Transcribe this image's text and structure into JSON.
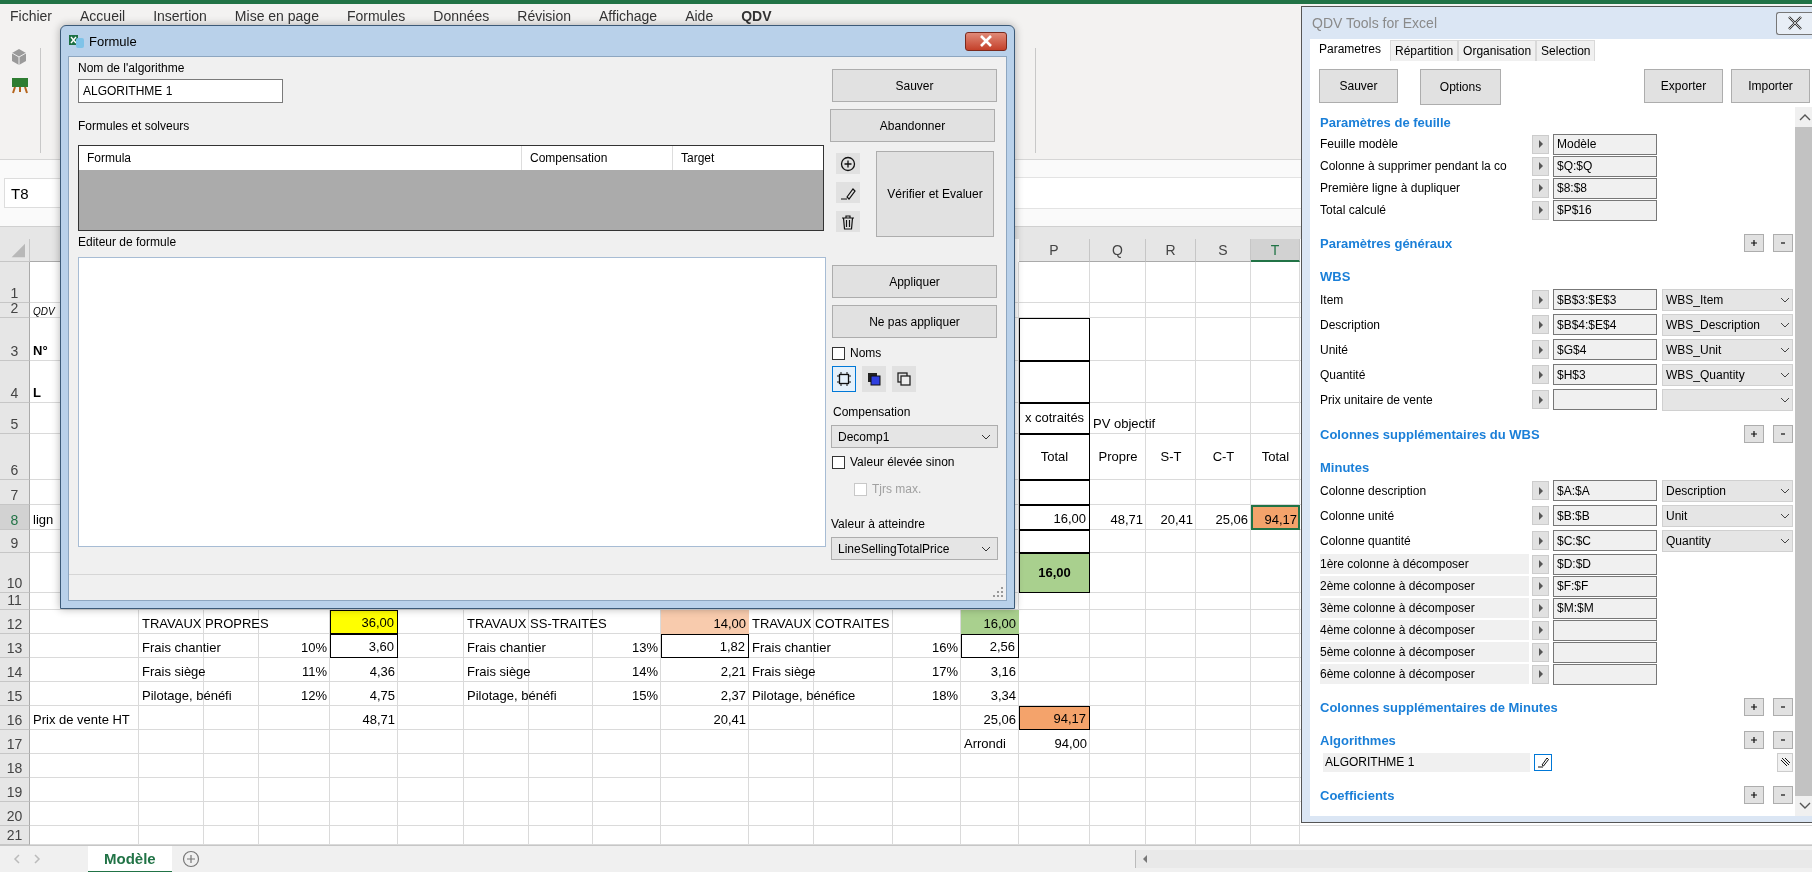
{
  "excel": {
    "menu": [
      {
        "label": "Fichier",
        "selected": false
      },
      {
        "label": "Accueil",
        "selected": false
      },
      {
        "label": "Insertion",
        "selected": false
      },
      {
        "label": "Mise en page",
        "selected": false
      },
      {
        "label": "Formules",
        "selected": false
      },
      {
        "label": "Données",
        "selected": false
      },
      {
        "label": "Révision",
        "selected": false
      },
      {
        "label": "Affichage",
        "selected": false
      },
      {
        "label": "Aide",
        "selected": false
      },
      {
        "label": "QDV",
        "selected": true
      }
    ],
    "name_box": {
      "value": "T8"
    },
    "columns": [
      {
        "letter": "P",
        "selected": false
      },
      {
        "letter": "Q",
        "selected": false
      },
      {
        "letter": "R",
        "selected": false
      },
      {
        "letter": "S",
        "selected": false
      },
      {
        "letter": "T",
        "selected": true
      }
    ],
    "rows": [
      {
        "label": "1",
        "selected": false
      },
      {
        "label": "2",
        "selected": false,
        "cells": {
          "A": {
            "text": "QDV",
            "kind": "note",
            "selected": false
          }
        }
      },
      {
        "label": "3",
        "selected": false,
        "cells": {
          "A": {
            "text": "N°",
            "kind": "text",
            "bold": true,
            "selected": false
          },
          "P": {
            "kind": "text",
            "boxed": true,
            "selected": false
          }
        }
      },
      {
        "label": "4",
        "selected": false,
        "cells": {
          "A": {
            "text": "L",
            "kind": "text",
            "bold": true,
            "selected": false
          },
          "P": {
            "kind": "text",
            "boxed": true,
            "selected": false
          }
        }
      },
      {
        "label": "5",
        "selected": false,
        "cells": {
          "P": {
            "text": "x cotraités",
            "kind": "head",
            "boxed": true,
            "selected": false
          },
          "Q": {
            "text": "PV objectif",
            "kind": "text",
            "selected": false
          }
        }
      },
      {
        "label": "6",
        "selected": false,
        "cells": {
          "P": {
            "text": "Total",
            "kind": "head",
            "boxed": true,
            "selected": false
          },
          "Q": {
            "text": "Propre",
            "kind": "head",
            "selected": false
          },
          "R": {
            "text": "S-T",
            "kind": "head",
            "selected": false
          },
          "S": {
            "text": "C-T",
            "kind": "head",
            "selected": false
          },
          "T": {
            "text": "Total",
            "kind": "head",
            "selected": false
          }
        }
      },
      {
        "label": "7",
        "selected": false,
        "cells": {
          "P": {
            "kind": "text",
            "boxed": true,
            "selected": false
          }
        }
      },
      {
        "label": "8",
        "selected": true,
        "cells": {
          "A": {
            "text": "lign",
            "kind": "text",
            "selected": false
          },
          "P": {
            "text": "16,00",
            "kind": "num",
            "boxed": true,
            "selected": false
          },
          "Q": {
            "text": "48,71",
            "kind": "num",
            "selected": false
          },
          "R": {
            "text": "20,41",
            "kind": "num",
            "selected": false
          },
          "S": {
            "text": "25,06",
            "kind": "num",
            "selected": false
          },
          "T": {
            "text": "94,17",
            "kind": "num",
            "color": "#f4a36b",
            "selected": true
          }
        }
      },
      {
        "label": "9",
        "selected": false,
        "cells": {
          "P": {
            "kind": "text",
            "boxed": true,
            "selected": false
          }
        }
      },
      {
        "label": "10",
        "selected": false,
        "cells": {
          "P": {
            "text": "16,00",
            "kind": "head",
            "bold": true,
            "boxed": true,
            "color": "#a9d08e",
            "selected": false
          }
        }
      },
      {
        "label": "11",
        "selected": false
      },
      {
        "label": "12",
        "selected": false,
        "cells": {
          "B": {
            "text": "TRAVAUX PROPRES",
            "kind": "text",
            "selected": false
          },
          "E": {
            "text": "36,00",
            "kind": "num",
            "boxed": true,
            "color": "#ffff00",
            "selected": false
          },
          "G": {
            "text": "TRAVAUX SS-TRAITES",
            "kind": "text",
            "selected": false
          },
          "J": {
            "text": "14,00",
            "kind": "num",
            "color": "#f8cbad",
            "selected": false
          },
          "K": {
            "text": "TRAVAUX COTRAITES",
            "kind": "text",
            "selected": false
          },
          "N": {
            "text": "16,00",
            "kind": "num",
            "color": "#a9d08e",
            "selected": false
          }
        }
      },
      {
        "label": "13",
        "selected": false,
        "cells": {
          "B": {
            "text": "Frais chantier",
            "kind": "text",
            "selected": false
          },
          "D": {
            "text": "10%",
            "kind": "num",
            "selected": false
          },
          "E": {
            "text": "3,60",
            "kind": "num",
            "boxed": true,
            "selected": false
          },
          "G": {
            "text": "Frais chantier",
            "kind": "text",
            "selected": false
          },
          "I": {
            "text": "13%",
            "kind": "num",
            "selected": false
          },
          "J": {
            "text": "1,82",
            "kind": "num",
            "boxed": true,
            "selected": false
          },
          "K": {
            "text": "Frais chantier",
            "kind": "text",
            "selected": false
          },
          "M": {
            "text": "16%",
            "kind": "num",
            "selected": false
          },
          "N": {
            "text": "2,56",
            "kind": "num",
            "boxed": true,
            "selected": false
          }
        }
      },
      {
        "label": "14",
        "selected": false,
        "cells": {
          "B": {
            "text": "Frais siège",
            "kind": "text",
            "selected": false
          },
          "D": {
            "text": "11%",
            "kind": "num",
            "selected": false
          },
          "E": {
            "text": "4,36",
            "kind": "num",
            "selected": false
          },
          "G": {
            "text": "Frais siège",
            "kind": "text",
            "selected": false
          },
          "I": {
            "text": "14%",
            "kind": "num",
            "selected": false
          },
          "J": {
            "text": "2,21",
            "kind": "num",
            "selected": false
          },
          "K": {
            "text": "Frais siège",
            "kind": "text",
            "selected": false
          },
          "M": {
            "text": "17%",
            "kind": "num",
            "selected": false
          },
          "N": {
            "text": "3,16",
            "kind": "num",
            "selected": false
          }
        }
      },
      {
        "label": "15",
        "selected": false,
        "cells": {
          "B": {
            "text": "Pilotage, bénéfi",
            "kind": "text",
            "selected": false
          },
          "D": {
            "text": "12%",
            "kind": "num",
            "selected": false
          },
          "E": {
            "text": "4,75",
            "kind": "num",
            "selected": false
          },
          "G": {
            "text": "Pilotage, bénéfi",
            "kind": "text",
            "selected": false
          },
          "I": {
            "text": "15%",
            "kind": "num",
            "selected": false
          },
          "J": {
            "text": "2,37",
            "kind": "num",
            "selected": false
          },
          "K": {
            "text": "Pilotage, bénéfice",
            "kind": "text",
            "selected": false
          },
          "M": {
            "text": "18%",
            "kind": "num",
            "selected": false
          },
          "N": {
            "text": "3,34",
            "kind": "num",
            "selected": false
          }
        }
      },
      {
        "label": "16",
        "selected": false,
        "cells": {
          "A": {
            "text": "Prix de vente HT",
            "kind": "text",
            "selected": false
          },
          "E": {
            "text": "48,71",
            "kind": "num",
            "selected": false
          },
          "J": {
            "text": "20,41",
            "kind": "num",
            "selected": false
          },
          "N": {
            "text": "25,06",
            "kind": "num",
            "selected": false
          },
          "P": {
            "text": "94,17",
            "kind": "num",
            "boxed": true,
            "color": "#f4a36b",
            "selected": false
          }
        }
      },
      {
        "label": "17",
        "selected": false,
        "cells": {
          "N": {
            "text": "Arrondi",
            "kind": "text",
            "selected": false
          },
          "P": {
            "text": "94,00",
            "kind": "num",
            "selected": false
          }
        }
      },
      {
        "label": "18",
        "selected": false
      },
      {
        "label": "19",
        "selected": false
      },
      {
        "label": "20",
        "selected": false
      },
      {
        "label": "21",
        "selected": false
      }
    ],
    "sheet_tabs": [
      {
        "label": "Modèle",
        "selected": true
      }
    ]
  },
  "formula_dialog": {
    "title": "Formule",
    "name_label": "Nom de l'algorithme",
    "name_value": "ALGORITHME 1",
    "top_buttons": [
      "Sauver",
      "Abandonner"
    ],
    "table_label": "Formules et solveurs",
    "table_columns": [
      "Formula",
      "Compensation",
      "Target"
    ],
    "verify_button": "Vérifier et Evaluer",
    "editor_label": "Editeur de formule",
    "apply_buttons": [
      "Appliquer",
      "Ne pas appliquer"
    ],
    "names_checkbox": {
      "label": "Noms",
      "checked": false
    },
    "view_buttons": [
      {
        "kind": "frame",
        "selected": true
      },
      {
        "kind": "filled",
        "selected": false
      },
      {
        "kind": "outline",
        "selected": false
      }
    ],
    "compensation": {
      "label": "Compensation",
      "value": "Decomp1"
    },
    "high_value": {
      "label": "Valeur élevée sinon",
      "checked": false,
      "disabled": false
    },
    "always_max": {
      "label": "Tjrs max.",
      "checked": false,
      "disabled": true
    },
    "target": {
      "label": "Valeur à atteindre",
      "value": "LineSellingTotalPrice"
    }
  },
  "tools_panel": {
    "title": "QDV Tools for Excel",
    "tabs": [
      {
        "label": "Parametres",
        "selected": true
      },
      {
        "label": "Répartition",
        "selected": false
      },
      {
        "label": "Organisation",
        "selected": false
      },
      {
        "label": "Selection",
        "selected": false
      }
    ],
    "buttons": [
      "Sauver",
      "Options",
      "Exporter",
      "Importer"
    ],
    "sections": [
      {
        "heading": "Paramètres de feuille",
        "add_remove": false,
        "rows": [
          {
            "label": "Feuille modèle",
            "kind": "ref",
            "value": "Modèle"
          },
          {
            "label": "Colonne à supprimer pendant la co",
            "kind": "ref",
            "value": "$Q:$Q"
          },
          {
            "label": "Première ligne à dupliquer",
            "kind": "ref",
            "value": "$8:$8"
          },
          {
            "label": "Total calculé",
            "kind": "ref",
            "value": "$P$16"
          }
        ]
      },
      {
        "heading": "Paramètres généraux",
        "add_remove": true
      },
      {
        "heading": "WBS",
        "add_remove": false,
        "rows": [
          {
            "label": "Item",
            "kind": "ref_select",
            "value": "$B$3:$E$3",
            "option": "WBS_Item"
          },
          {
            "label": "Description",
            "kind": "ref_select",
            "value": "$B$4:$E$4",
            "option": "WBS_Description"
          },
          {
            "label": "Unité",
            "kind": "ref_select",
            "value": "$G$4",
            "option": "WBS_Unit"
          },
          {
            "label": "Quantité",
            "kind": "ref_select",
            "value": "$H$3",
            "option": "WBS_Quantity"
          },
          {
            "label": "Prix unitaire de vente",
            "kind": "ref_select"
          }
        ]
      },
      {
        "heading": "Colonnes supplémentaires du WBS",
        "add_remove": true
      },
      {
        "heading": "Minutes",
        "add_remove": false,
        "rows": [
          {
            "label": "Colonne description",
            "kind": "ref_select",
            "value": "$A:$A",
            "option": "Description"
          },
          {
            "label": "Colonne unité",
            "kind": "ref_select",
            "value": "$B:$B",
            "option": "Unit"
          },
          {
            "label": "Colonne quantité",
            "kind": "ref_select",
            "value": "$C:$C",
            "option": "Quantity"
          },
          {
            "label": "1ère colonne à décomposer",
            "kind": "shaded_ref",
            "value": "$D:$D"
          },
          {
            "label": "2ème colonne à décomposer",
            "kind": "shaded_ref",
            "value": "$F:$F"
          },
          {
            "label": "3ème colonne à décomposer",
            "kind": "shaded_ref",
            "value": "$M:$M"
          },
          {
            "label": "4ème colonne à décomposer",
            "kind": "shaded_ref"
          },
          {
            "label": "5ème colonne à décomposer",
            "kind": "shaded_ref"
          },
          {
            "label": "6ème colonne à décomposer",
            "kind": "shaded_ref"
          }
        ]
      },
      {
        "heading": "Colonnes supplémentaires de Minutes",
        "add_remove": true
      },
      {
        "heading": "Algorithmes",
        "add_remove": true,
        "rows": [
          {
            "label": "ALGORITHME 1",
            "kind": "algorithm"
          }
        ]
      },
      {
        "heading": "Coefficients",
        "add_remove": true
      }
    ]
  }
}
